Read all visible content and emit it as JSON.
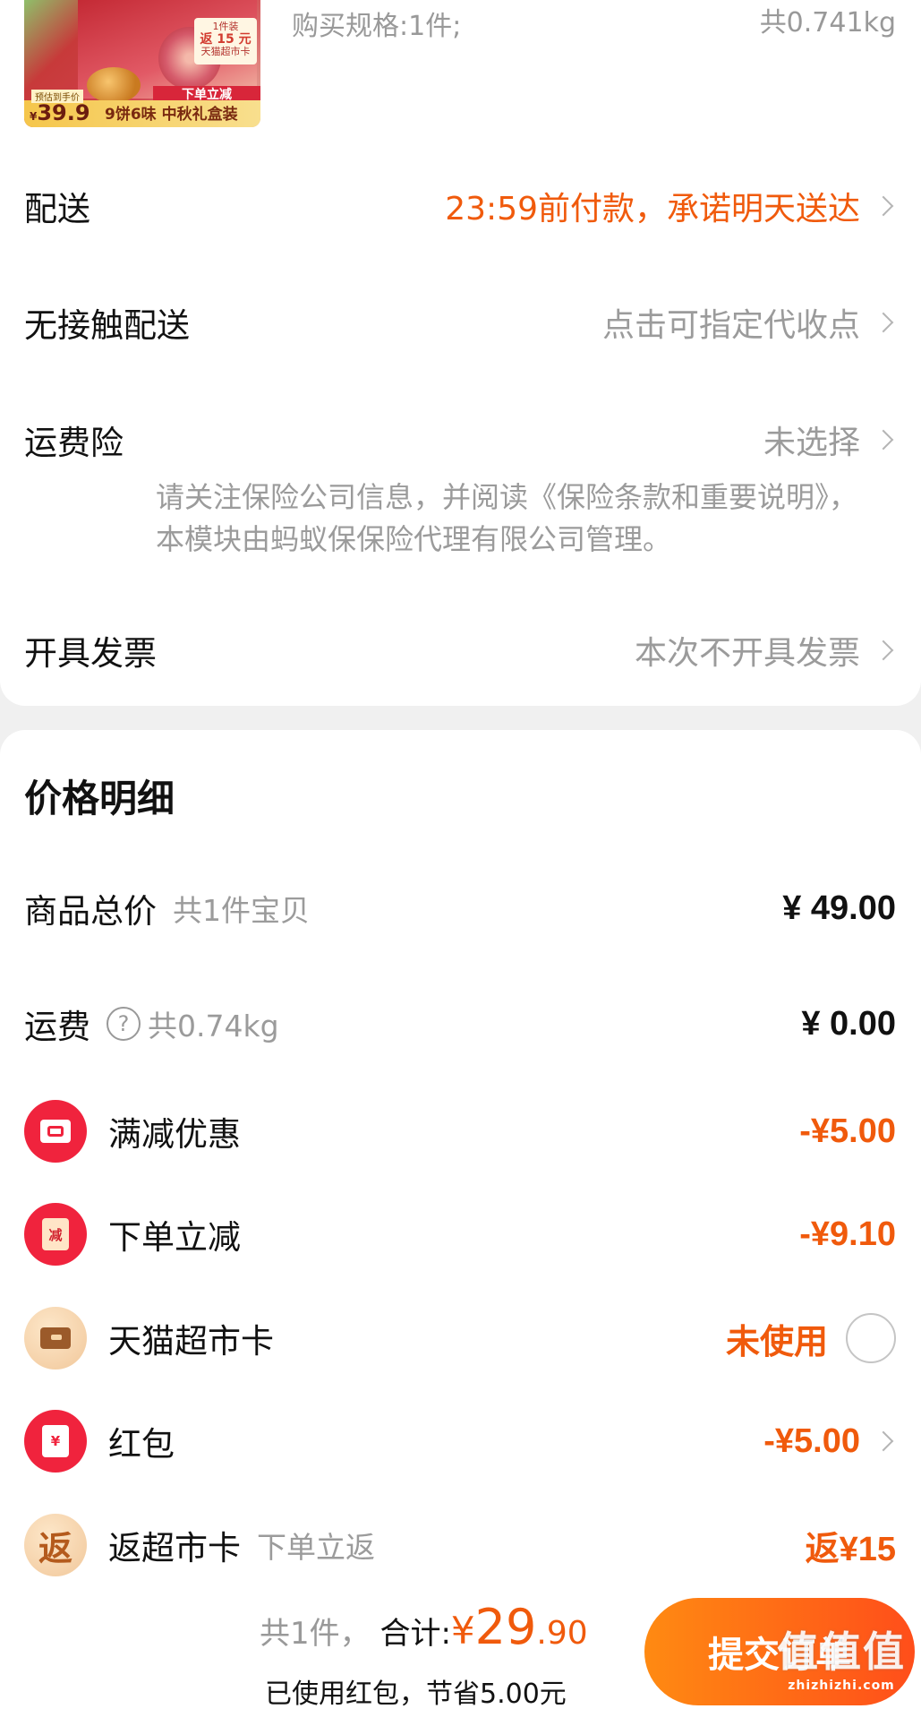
{
  "product": {
    "thumb_tag_line1": "1件装",
    "thumb_tag_big": "返 15 元",
    "thumb_tag_line3": "天猫超市卡",
    "thumb_ribbon": "下单立减",
    "thumb_price_label": "预估到手价",
    "thumb_price_symbol": "¥",
    "thumb_price": "39.9",
    "thumb_desc": "9饼6味 中秋礼盒装",
    "spec": "购买规格:1件;",
    "weight": "共0.741kg"
  },
  "order_options": {
    "delivery_label": "配送",
    "delivery_value": "23:59前付款，承诺明天送达",
    "contactless_label": "无接触配送",
    "contactless_value": "点击可指定代收点",
    "insurance_label": "运费险",
    "insurance_value": "未选择",
    "insurance_note": "请关注保险公司信息，并阅读《保险条款和重要说明》，本模块由蚂蚁保保险代理有限公司管理。",
    "invoice_label": "开具发票",
    "invoice_value": "本次不开具发票"
  },
  "price_detail": {
    "title": "价格明细",
    "goods_label": "商品总价",
    "goods_sub": "共1件宝贝",
    "goods_amount": "¥ 49.00",
    "shipping_label": "运费",
    "shipping_help": "?",
    "shipping_sub": "共0.74kg",
    "shipping_amount": "¥ 0.00",
    "full_discount_label": "满减优惠",
    "full_discount_amount": "-¥5.00",
    "order_discount_label": "下单立减",
    "order_discount_icon_text": "减",
    "order_discount_amount": "-¥9.10",
    "market_card_label": "天猫超市卡",
    "market_card_status": "未使用",
    "red_packet_label": "红包",
    "red_packet_icon_text": "¥",
    "red_packet_amount": "-¥5.00",
    "rebate_label": "返超市卡",
    "rebate_icon_text": "返",
    "rebate_sub": "下单立返",
    "rebate_amount": "返¥15"
  },
  "bottom_bar": {
    "count_text": "共1件，",
    "total_label": "合计:",
    "total_yen": "¥",
    "total_int": "29",
    "total_dec": ".90",
    "saved_text": "已使用红包，节省5.00元",
    "submit_label": "提交订单",
    "watermark": "值值值",
    "watermark_url": "zhizhizhi.com"
  },
  "colors": {
    "accent": "#f05a0c",
    "discount_red": "#f0233d",
    "button_start": "#ff8a12",
    "button_end": "#ff4e1a"
  }
}
